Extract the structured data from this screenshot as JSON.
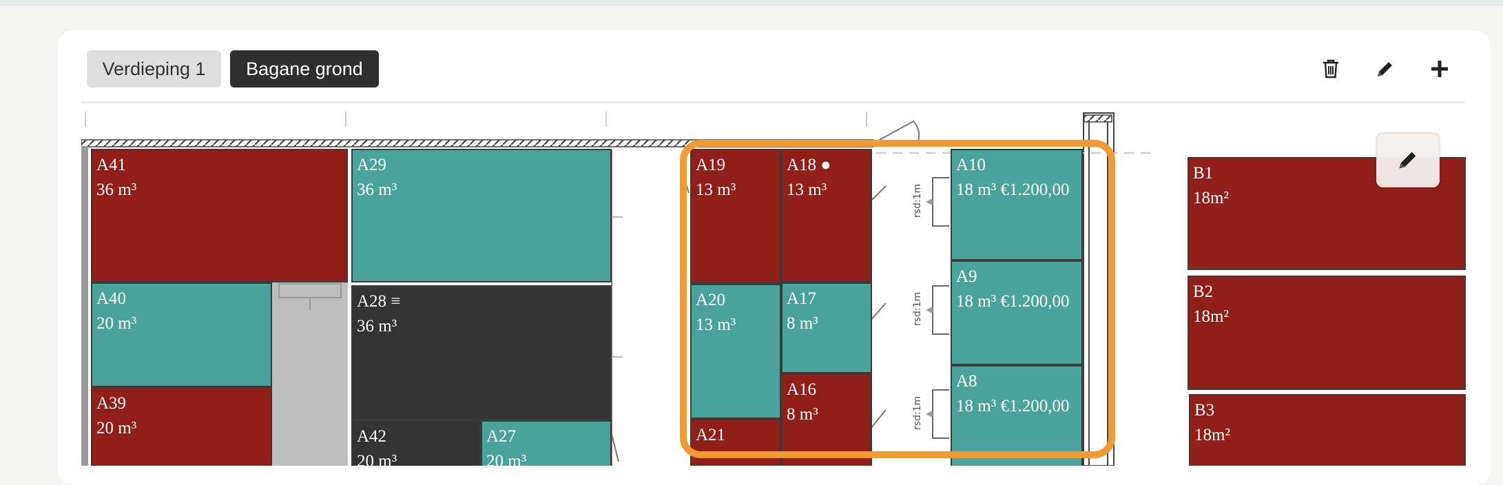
{
  "tabs": {
    "floor1": "Verdieping 1",
    "ground": "Bagane grond"
  },
  "toolbar": {
    "delete_icon": "trash-icon",
    "edit_icon": "pencil-icon",
    "add_icon": "plus-icon"
  },
  "colors": {
    "occupied": "#8f1f18",
    "available": "#4aa39a",
    "blocked": "#333333",
    "highlight": "#ef9a32"
  },
  "markers": {
    "rsd": "rsd:1m"
  },
  "units": {
    "A41": {
      "name": "A41",
      "size": "36 m³"
    },
    "A29": {
      "name": "A29",
      "size": "36 m³"
    },
    "A40": {
      "name": "A40",
      "size": "20 m³"
    },
    "A28": {
      "name": "A28 ≡",
      "size": "36 m³"
    },
    "A39": {
      "name": "A39",
      "size": "20 m³"
    },
    "A42": {
      "name": "A42",
      "size": "20 m³"
    },
    "A27": {
      "name": "A27",
      "size": "20 m³"
    },
    "A19": {
      "name": "A19",
      "size": "13 m³"
    },
    "A18": {
      "name": "A18 ●",
      "size": "13 m³"
    },
    "A20": {
      "name": "A20",
      "size": "13 m³"
    },
    "A17": {
      "name": "A17",
      "size": "8 m³"
    },
    "A16": {
      "name": "A16",
      "size": "8 m³"
    },
    "A21": {
      "name": "A21",
      "size": ""
    },
    "A10": {
      "name": "A10",
      "size": "18 m³ €1.200,00"
    },
    "A9": {
      "name": "A9",
      "size": "18 m³ €1.200,00"
    },
    "A8": {
      "name": "A8",
      "size": "18 m³ €1.200,00"
    },
    "B1": {
      "name": "B1",
      "size": "18m²"
    },
    "B2": {
      "name": "B2",
      "size": "18m²"
    },
    "B3": {
      "name": "B3",
      "size": "18m²"
    }
  }
}
